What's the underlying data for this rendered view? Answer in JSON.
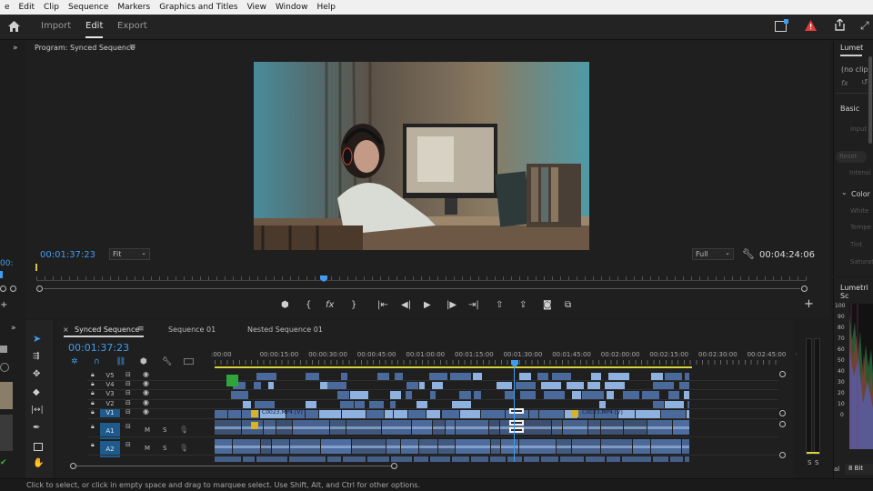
{
  "menu": [
    "e",
    "Edit",
    "Clip",
    "Sequence",
    "Markers",
    "Graphics and Titles",
    "View",
    "Window",
    "Help"
  ],
  "workspace": {
    "tabs": [
      "Import",
      "Edit",
      "Export"
    ],
    "active": "Edit"
  },
  "program": {
    "title": "Program: Synced Sequence",
    "timecode_current": "00:01:37:23",
    "timecode_duration": "00:04:24:06",
    "fit_label": "Fit",
    "quality_label": "Full",
    "playhead_position": 0.35
  },
  "left_edge": {
    "timecode": "00:"
  },
  "lumetri": {
    "tab": "Lumet",
    "no_clip": "(no clip",
    "fx": "fx",
    "basic": "Basic",
    "input": "Input L",
    "reset": "Reset",
    "intensity": "Intensi",
    "color": "Color",
    "white": "White",
    "temp": "Tempe",
    "tint": "Tint",
    "saturation": "Saturat"
  },
  "scopes": {
    "tab": "Lumetri Sc",
    "scale": [
      "100",
      "90",
      "80",
      "70",
      "60",
      "50",
      "40",
      "30",
      "20",
      "10",
      "0"
    ],
    "bits": "8 Bit",
    "lab": "al"
  },
  "timeline": {
    "tabs": [
      "Synced Sequence",
      "Sequence 01",
      "Nested Sequence 01"
    ],
    "active_tab": "Synced Sequence",
    "timecode": "00:01:37:23",
    "ruler": [
      ":00:00",
      "00:00:15:00",
      "00:00:30:00",
      "00:00:45:00",
      "00:01:00:00",
      "00:01:15:00",
      "00:01:30:00",
      "00:01:45:00",
      "00:02:00:00",
      "00:02:15:00",
      "00:02:30:00",
      "00:02:45:00",
      "00:0"
    ],
    "video_tracks": [
      "V5",
      "V4",
      "V3",
      "V2",
      "V1"
    ],
    "audio_tracks": [
      "A1",
      "A2"
    ],
    "track_m": "M",
    "track_s": "S",
    "clip_label_1": "C0023.MP4 [V]",
    "clip_label_2": "C0023.MP4 [V]",
    "playhead_position": 0.53
  },
  "meter": {
    "labels": [
      "S",
      "S"
    ]
  },
  "status": "Click to select, or click in empty space and drag to marquee select. Use Shift, Alt, and Ctrl for other options.",
  "colors": {
    "accent": "#3f9cf2",
    "warning": "#e23b3b",
    "timeline_clip": "#8fb1e0",
    "track_highlight": "#1f5a8c"
  }
}
